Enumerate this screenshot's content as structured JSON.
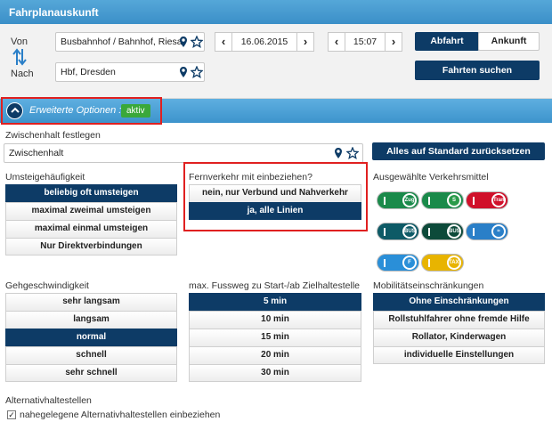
{
  "header": {
    "title": "Fahrplanauskunft"
  },
  "trip": {
    "from_label": "Von",
    "to_label": "Nach",
    "from_value": "Busbahnhof / Bahnhof, Riesa",
    "to_value": "Hbf, Dresden",
    "date": "16.06.2015",
    "time": "15:07",
    "departure_label": "Abfahrt",
    "arrival_label": "Ankunft",
    "search_label": "Fahrten suchen",
    "prev_symbol": "‹",
    "next_symbol": "›"
  },
  "options_bar": {
    "label": "Erweiterte Optionen :",
    "status": "aktiv"
  },
  "via": {
    "label": "Zwischenhalt festlegen",
    "value": "Zwischenhalt",
    "reset_label": "Alles auf Standard zurücksetzen"
  },
  "transfers": {
    "label": "Umsteigehäufigkeit",
    "options": [
      "beliebig oft umsteigen",
      "maximal zweimal umsteigen",
      "maximal einmal umsteigen",
      "Nur Direktverbindungen"
    ],
    "selected": 0
  },
  "long_distance": {
    "label": "Fernverkehr mit einbeziehen?",
    "options": [
      "nein, nur Verbund und Nahverkehr",
      "ja, alle Linien"
    ],
    "selected": 1
  },
  "modes": {
    "label": "Ausgewählte Verkehrsmittel",
    "items": [
      {
        "name": "zug",
        "icon_text": "Zug",
        "track_color": "#1a8a4a",
        "icon_color": "#1a8a4a"
      },
      {
        "name": "s-bahn",
        "icon_text": "S",
        "track_color": "#1a8a4a",
        "icon_color": "#2a9a4a"
      },
      {
        "name": "tram",
        "icon_text": "Tram",
        "track_color": "#d0102a",
        "icon_color": "#d0102a"
      },
      {
        "name": "stadtbus",
        "icon_text": "BUS",
        "track_color": "#0d5a66",
        "icon_color": "#0d5a66"
      },
      {
        "name": "regionalbus",
        "icon_text": "BUS",
        "track_color": "#0d4a3a",
        "icon_color": "#0d4a3a"
      },
      {
        "name": "faehre-bus",
        "icon_text": "≈",
        "track_color": "#2a7fc8",
        "icon_color": "#2a7fc8"
      },
      {
        "name": "faehre",
        "icon_text": "F",
        "track_color": "#2a8fd8",
        "icon_color": "#2a8fd8"
      },
      {
        "name": "taxi",
        "icon_text": "TAXI",
        "track_color": "#e8b400",
        "icon_color": "#e8b400"
      }
    ]
  },
  "walk_speed": {
    "label": "Gehgeschwindigkeit",
    "options": [
      "sehr langsam",
      "langsam",
      "normal",
      "schnell",
      "sehr schnell"
    ],
    "selected": 2
  },
  "walk_distance": {
    "label": "max. Fussweg zu Start-/ab Zielhaltestelle",
    "options": [
      "5 min",
      "10 min",
      "15 min",
      "20 min",
      "30 min"
    ],
    "selected": 0
  },
  "mobility": {
    "label": "Mobilitätseinschränkungen",
    "options": [
      "Ohne Einschränkungen",
      "Rollstuhlfahrer ohne fremde Hilfe",
      "Rollator, Kinderwagen",
      "individuelle Einstellungen"
    ],
    "selected": 0
  },
  "alternatives": {
    "label": "Alternativhaltestellen",
    "checkbox_label": "nahegelegene Alternativhaltestellen einbeziehen",
    "checked": true
  },
  "colors": {
    "primary": "#0d3b66",
    "accent": "#4aa0d8",
    "highlight": "#e02020",
    "active": "#3aa83a"
  }
}
